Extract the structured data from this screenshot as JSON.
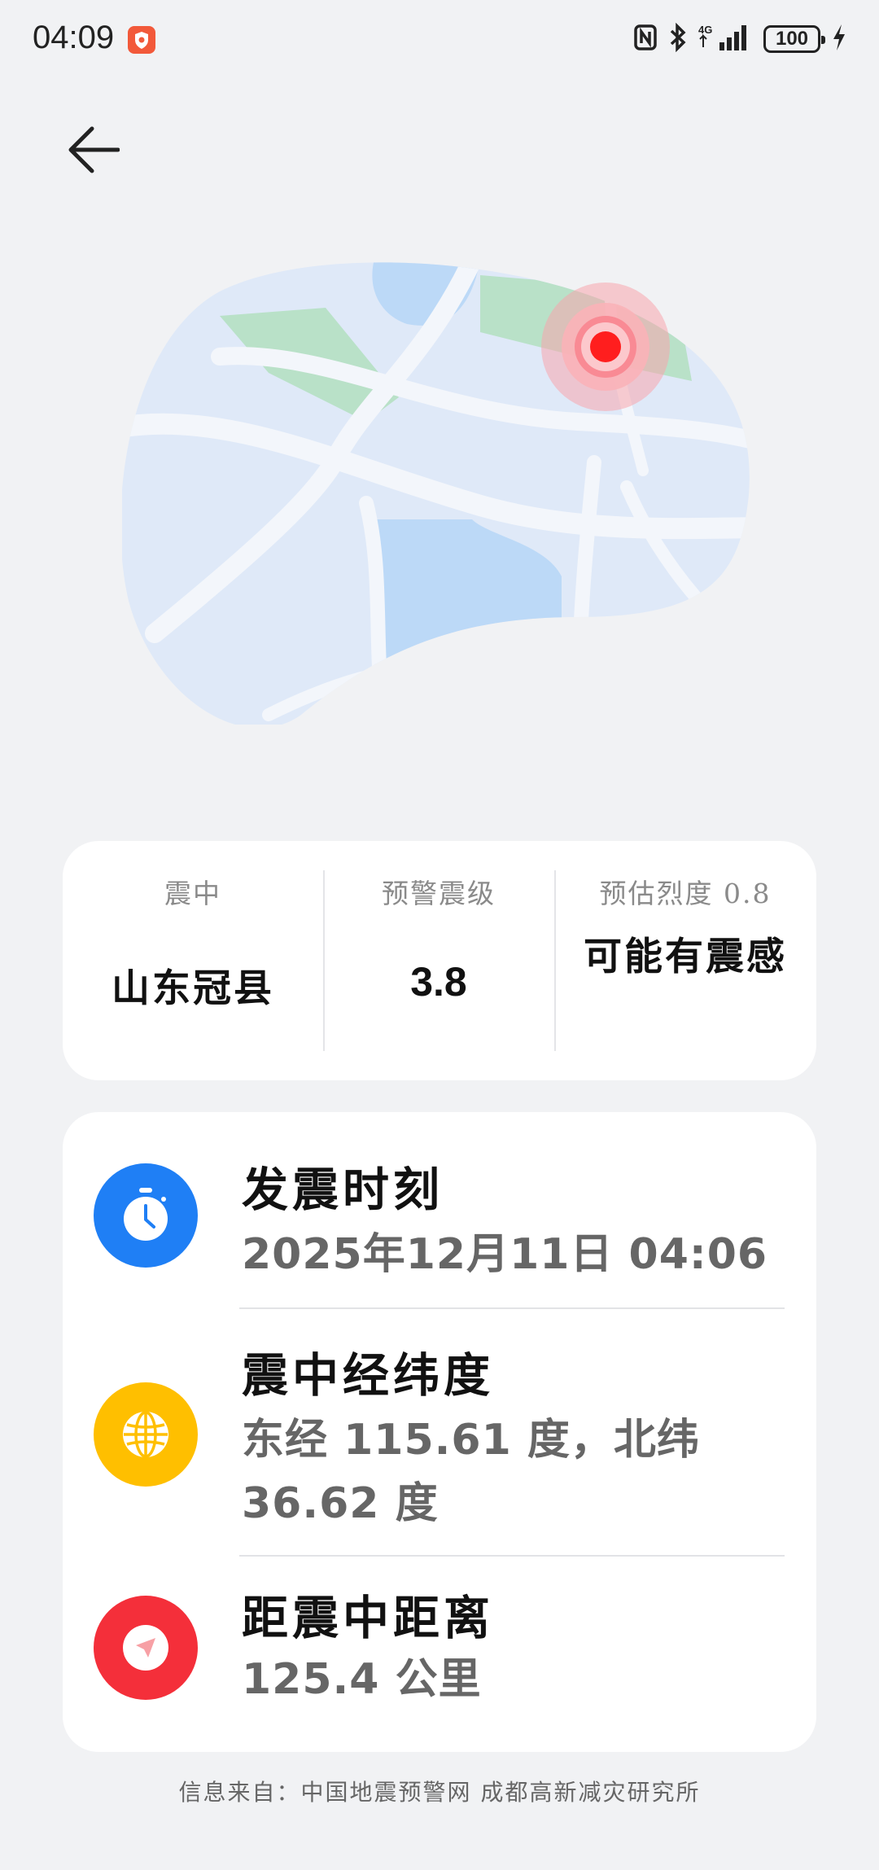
{
  "status_bar": {
    "time": "04:09",
    "network": "4G",
    "battery": "100"
  },
  "back_icon": "arrow-left-icon",
  "map": {
    "epicenter_color": "#ff1e1e",
    "land_color": "#dfe9f8",
    "road_color": "#f3f6fb",
    "water_color": "#bcd9f7",
    "park_color": "#b9e1c8"
  },
  "summary": {
    "epicenter_label": "震中",
    "epicenter_value": "山东冠县",
    "magnitude_label": "预警震级",
    "magnitude_value": "3.8",
    "intensity_label": "预估烈度 0.8",
    "intensity_value": "可能有震感"
  },
  "details": [
    {
      "icon": "clock-icon",
      "icon_color": "#1f7ff5",
      "title": "发震时刻",
      "value": "2025年12月11日  04:06"
    },
    {
      "icon": "globe-icon",
      "icon_color": "#ffbf00",
      "title": "震中经纬度",
      "value": "东经 115.61 度，北纬 36.62 度"
    },
    {
      "icon": "navigation-arrow-icon",
      "icon_color": "#f42f3a",
      "title": "距震中距离",
      "value": "125.4 公里"
    }
  ],
  "footer": {
    "source": "信息来自：中国地震预警网 成都高新减灾研究所"
  }
}
